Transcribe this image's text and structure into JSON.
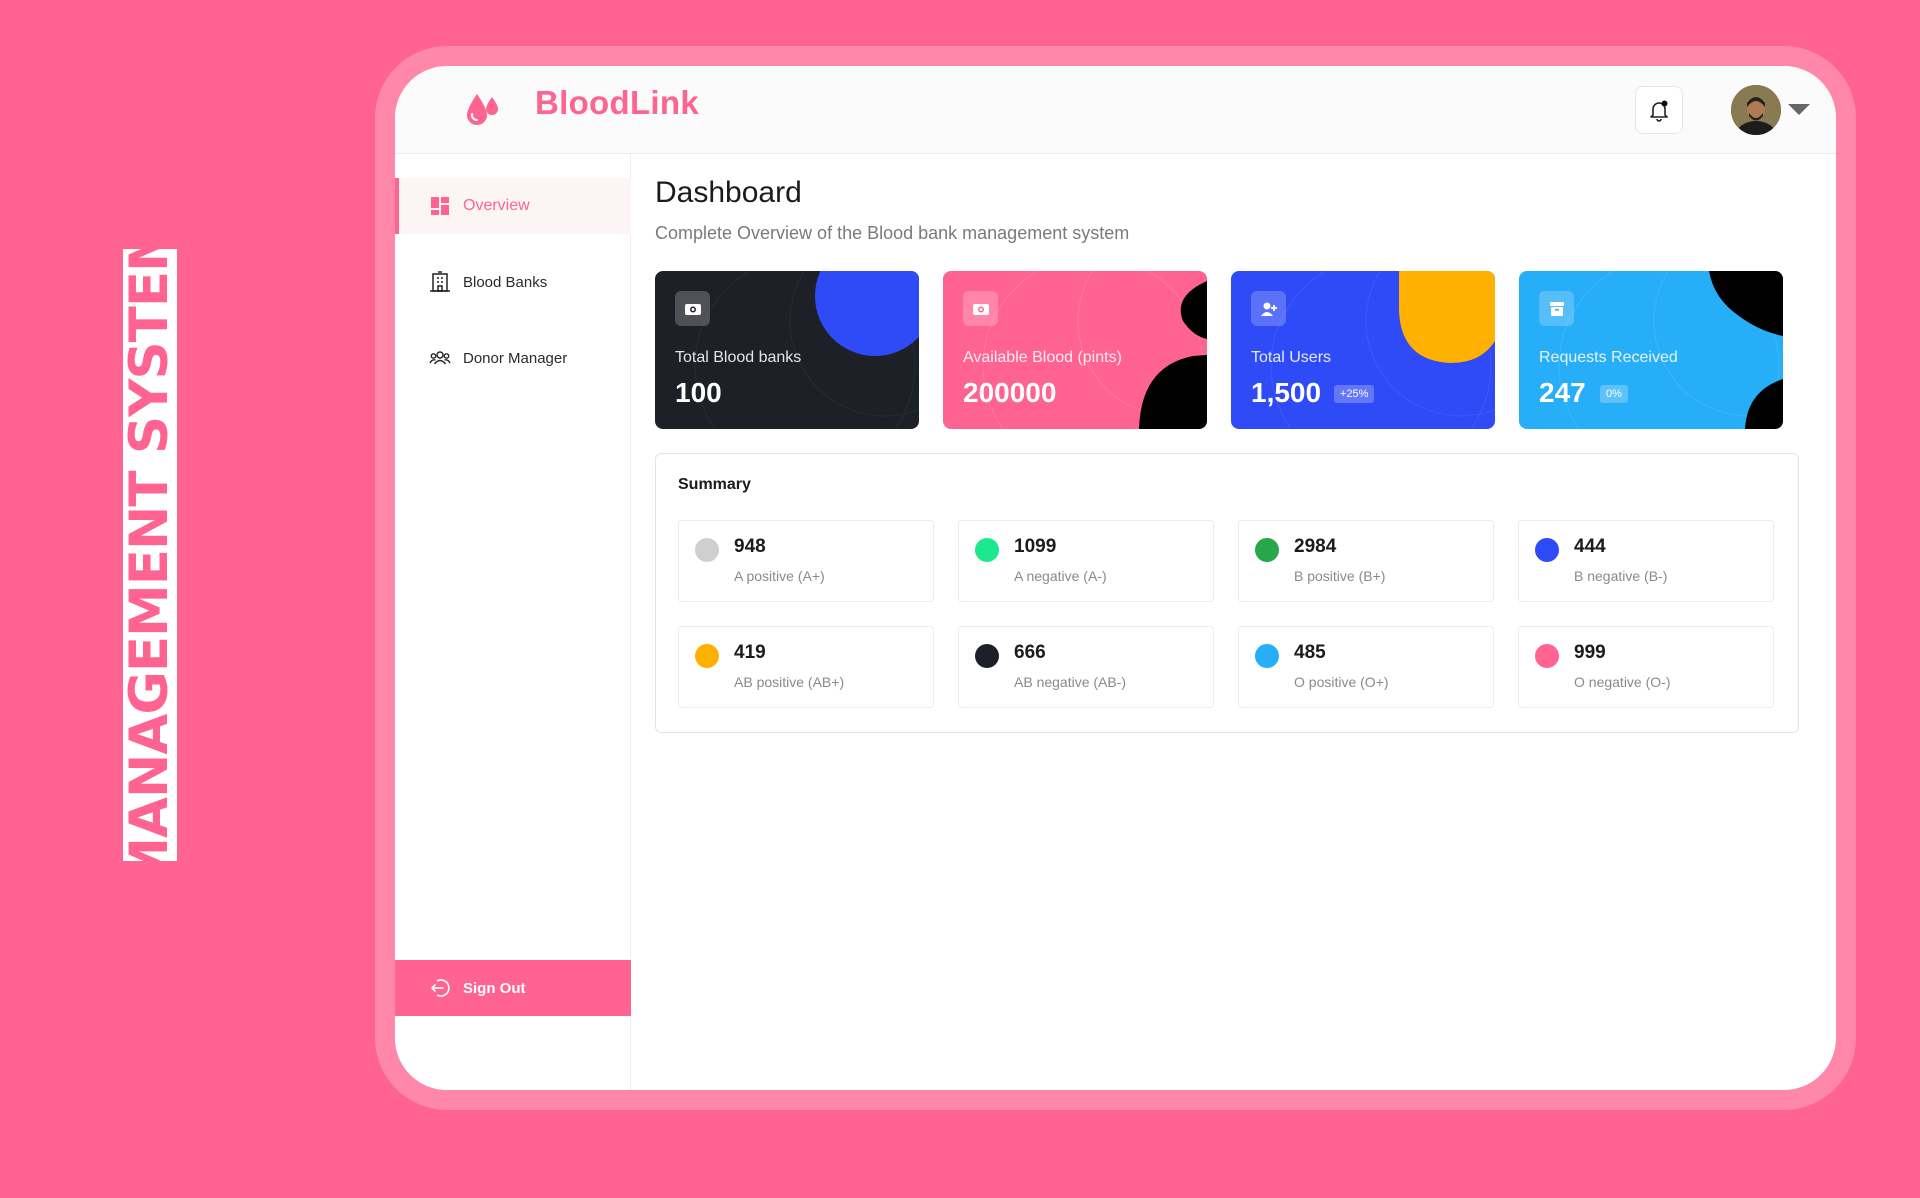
{
  "banner": {
    "text": "MANAGEMENT SYSTEM"
  },
  "app": {
    "name": "BloodLink"
  },
  "header": {
    "notification_icon": "bell-icon",
    "avatar_alt": "avatar"
  },
  "sidebar": {
    "items": [
      {
        "label": "Overview",
        "icon": "dashboard-icon",
        "active": true
      },
      {
        "label": "Blood Banks",
        "icon": "building-icon",
        "active": false
      },
      {
        "label": "Donor Manager",
        "icon": "users-icon",
        "active": false
      }
    ],
    "signout_label": "Sign Out"
  },
  "main": {
    "title": "Dashboard",
    "subtitle": "Complete Overview of the Blood bank management system"
  },
  "stats": [
    {
      "label": "Total Blood banks",
      "value": "100",
      "badge": "",
      "color": "#1e2028",
      "icon": "camera-icon"
    },
    {
      "label": "Available Blood (pints)",
      "value": "200000",
      "badge": "",
      "color": "#ff6392",
      "icon": "camera-icon"
    },
    {
      "label": "Total Users",
      "value": "1,500",
      "badge": "+25%",
      "color": "#2e4bf7",
      "icon": "add-user-icon"
    },
    {
      "label": "Requests Received",
      "value": "247",
      "badge": "0%",
      "color": "#27aef8",
      "icon": "archive-icon"
    }
  ],
  "summary": {
    "title": "Summary",
    "items": [
      {
        "value": "948",
        "name": "A positive (A+)",
        "color": "#cfcfcf"
      },
      {
        "value": "1099",
        "name": "A negative (A-)",
        "color": "#1ee88f"
      },
      {
        "value": "2984",
        "name": "B positive (B+)",
        "color": "#27a74a"
      },
      {
        "value": "444",
        "name": "B negative (B-)",
        "color": "#2e4bf7"
      },
      {
        "value": "419",
        "name": "AB positive (AB+)",
        "color": "#ffb000"
      },
      {
        "value": "666",
        "name": "AB negative (AB-)",
        "color": "#1e2028"
      },
      {
        "value": "485",
        "name": "O positive (O+)",
        "color": "#27aef8"
      },
      {
        "value": "999",
        "name": "O negative (O-)",
        "color": "#ff6392"
      }
    ]
  },
  "colors": {
    "accent": "#ff6392",
    "frame": "#ff87a9"
  }
}
